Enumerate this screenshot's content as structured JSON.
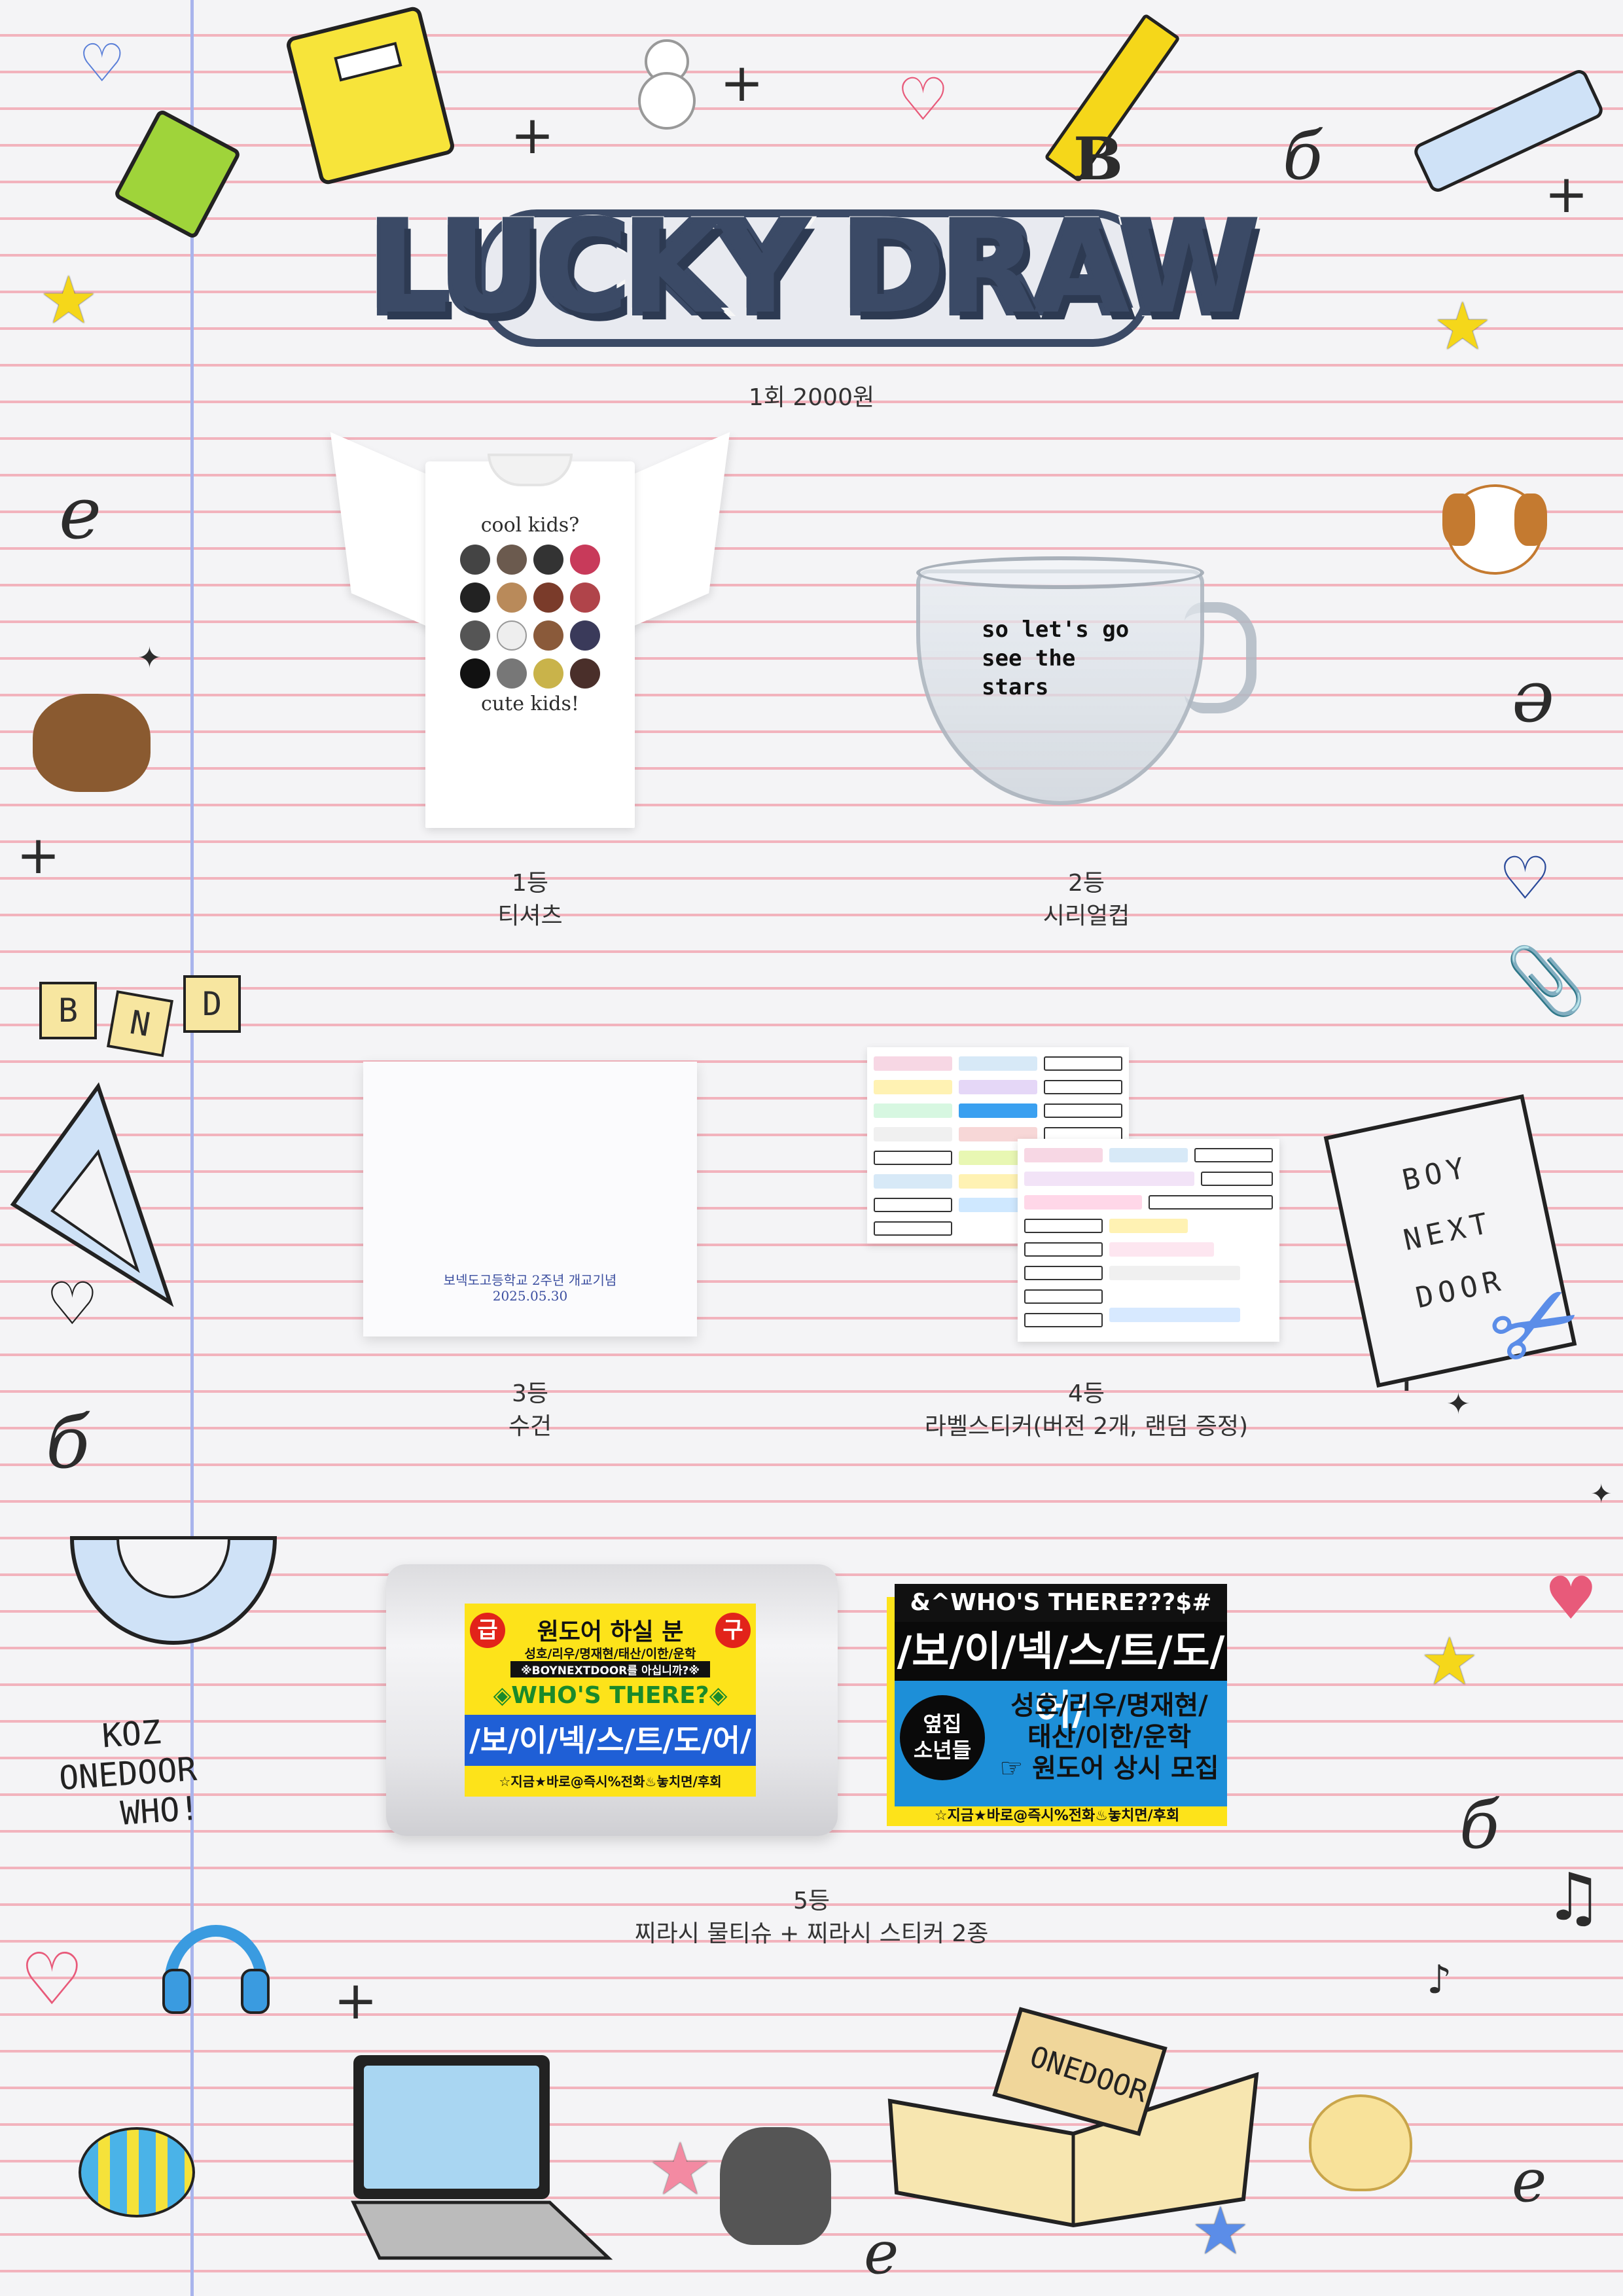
{
  "header": {
    "title": "LUCKY DRAW",
    "price": "1회 2000원"
  },
  "prizes": [
    {
      "rank": "1등",
      "name": "티셔츠"
    },
    {
      "rank": "2등",
      "name": "시리얼컵"
    },
    {
      "rank": "3등",
      "name": "수건"
    },
    {
      "rank": "4등",
      "name": "라벨스티커(버전 2개, 랜덤 증정)"
    },
    {
      "rank": "5등",
      "name": "찌라시 물티슈 + 찌라시 스티커 2종"
    }
  ],
  "tshirt": {
    "top_text": "cool kids?",
    "bottom_text": "cute kids!"
  },
  "cup": {
    "text_line1": "so let's go",
    "text_line2": "see the",
    "text_line3": "stars"
  },
  "towel": {
    "line1": "보넥도고등학교 2주년 개교기념",
    "line2": "2025.05.30"
  },
  "tissue": {
    "left_badge": "급",
    "right_badge": "구",
    "headline": "원도어 하실 분",
    "members": "성호/리우/명재현/태산/이한/운학",
    "question": "※BOYNEXTDOOR를 아십니까?※",
    "who": "◈WHO'S THERE?◈",
    "group": "/보/이/넥/스/트/도/어/",
    "footer": "☆지금★바로@즉시%전화♨놓치면/후회"
  },
  "sticker2": {
    "top": "&^WHO'S THERE???$#",
    "group": "/보/이/넥/스/트/도/어/",
    "circle_line1": "옆집",
    "circle_line2": "소년들",
    "members_line1": "성호/리우/명재현/",
    "members_line2": "태산/이한/운학",
    "recruit": "☞ 원도어 상시 모집",
    "footer": "☆지금★바로@즉시%전화♨놓치면/후회"
  },
  "doodles": {
    "koz_line1": "KOZ",
    "koz_line2": "ONEDOOR",
    "koz_line3": "WHO!",
    "book_label": "ONEDOOR",
    "bnd_letters": [
      "B",
      "N",
      "D"
    ],
    "note_words": [
      "BOY",
      "NEXT",
      "DOOR"
    ]
  },
  "colors": {
    "title": "#3b4a66",
    "line_pink": "#f2b3bd",
    "margin_blue": "#a9b4ec",
    "tissue_yellow": "#fde31a",
    "tissue_red": "#e2231a",
    "sticker_blue": "#1d8fd8"
  }
}
